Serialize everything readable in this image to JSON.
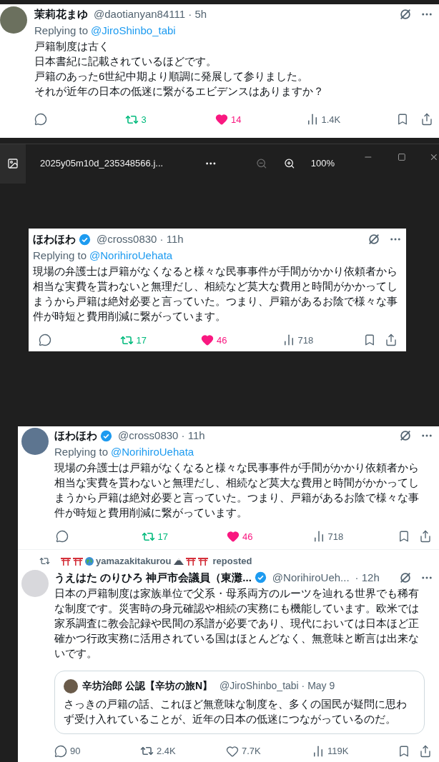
{
  "top_tweet": {
    "name": "茉莉花まゆ",
    "verified": false,
    "handle": "@daotianyan84111 · 5h",
    "replying_label": "Replying to",
    "replying_to": "@JiroShinbo_tabi",
    "lines": [
      "戸籍制度は古く",
      "日本書紀に記載されているほどです。",
      "戸籍のあった6世紀中期より順調に発展して参りました。",
      "それが近年の日本の低迷に繋がるエビデンスはありますか？"
    ],
    "stats": {
      "reposts": "3",
      "likes": "14",
      "views": "1.4K",
      "reposted": true,
      "liked": true
    }
  },
  "viewer": {
    "file_name": "2025y05m10d_235348566.j...",
    "zoom": "100%",
    "zoom_out_disabled": true,
    "tweet": {
      "name": "ほわほわ",
      "verified": true,
      "handle": "@cross0830 · 11h",
      "replying_label": "Replying to",
      "replying_to": "@NorihiroUehata",
      "lines": [
        "現場の弁護士は戸籍がなくなると様々な民事事件が手間がかかり依頼者から相当な実費を貰わないと無理だし、相続など莫大な費用と時間がかかってしまうから戸籍は絶対必要と言っていた。つまり、戸籍があるお陰で様々な事件が時短と費用削減に繋がっています。"
      ],
      "stats": {
        "reposts": "17",
        "likes": "46",
        "views": "718",
        "reposted": true,
        "liked": true
      }
    }
  },
  "thread": {
    "tweet": {
      "name": "ほわほわ",
      "verified": true,
      "handle": "@cross0830 · 11h",
      "replying_label": "Replying to",
      "replying_to": "@NorihiroUehata",
      "lines": [
        "現場の弁護士は戸籍がなくなると様々な民事事件が手間がかかり依頼者から相当な実費を貰わないと無理だし、相続など莫大な費用と時間がかかってしまうから戸籍は絶対必要と言っていた。つまり、戸籍があるお陰で様々な事件が時短と費用削減に繋がっています。"
      ],
      "stats": {
        "reposts": "17",
        "likes": "46",
        "views": "718",
        "reposted": true,
        "liked": true
      }
    },
    "repost": {
      "reposter": "yamazakitakurou",
      "label": "reposted",
      "tweet": {
        "name": "うえはた のりひろ 神戸市会議員（東灘...",
        "verified": true,
        "handle": "@NorihiroUeh...",
        "time": "· 12h",
        "lines": [
          "日本の戸籍制度は家族単位で父系・母系両方のルーツを辿れる世界でも稀有な制度です。災害時の身元確認や相続の実務にも機能しています。欧米では家系調査に教会記録や民間の系譜が必要であり、現代においては日本ほど正確かつ行政実務に活用されている国はほとんどなく、無意味と断言は出来ないです。"
        ],
        "quote": {
          "name": "辛坊治郎 公認【辛坊の旅N】",
          "handle": "@JiroShinbo_tabi · May 9",
          "text": "さっきの戸籍の話、これほど無意味な制度を、多くの国民が疑問に思わず受け入れていることが、近年の日本の低迷につながっているのだ。"
        },
        "stats": {
          "replies": "90",
          "reposts": "2.4K",
          "likes": "7.7K",
          "views": "119K",
          "reposted": false,
          "liked": false
        }
      }
    }
  }
}
